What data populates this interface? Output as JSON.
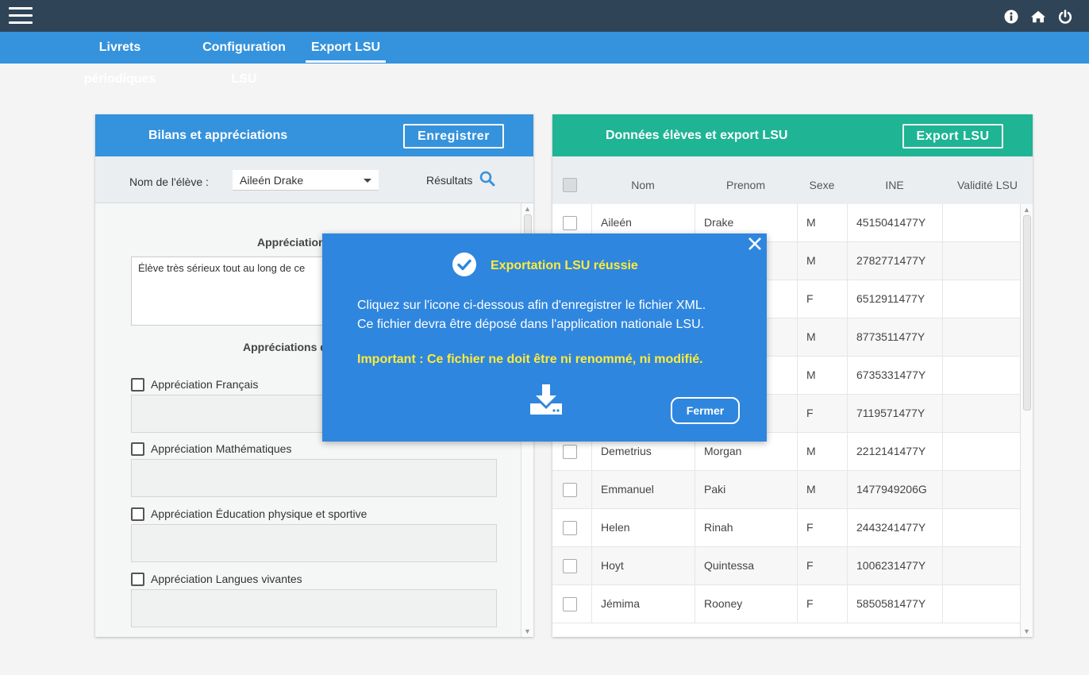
{
  "nav": {
    "tabs": [
      {
        "label": "Livrets périodiques",
        "active": false
      },
      {
        "label": "Configuration LSU",
        "active": false
      },
      {
        "label": "Export LSU",
        "active": true
      }
    ]
  },
  "left_panel": {
    "title": "Bilans et appréciations",
    "save_label": "Enregistrer",
    "student_label": "Nom de l'élève :",
    "student_selected": "Aileén Drake",
    "results_label": "Résultats",
    "general_title": "Appréciation",
    "general_text": "Élève très sérieux tout au long de ce",
    "subjects_title": "Appréciations d",
    "subjects": [
      {
        "label": "Appréciation Français"
      },
      {
        "label": "Appréciation Mathématiques"
      },
      {
        "label": "Appréciation Éducation physique et sportive"
      },
      {
        "label": "Appréciation Langues vivantes"
      }
    ]
  },
  "right_panel": {
    "title": "Données élèves et export LSU",
    "export_label": "Export LSU",
    "columns": [
      "Nom",
      "Prenom",
      "Sexe",
      "INE",
      "Validité LSU"
    ],
    "rows": [
      {
        "nom": "Aileén",
        "prenom": "Drake",
        "sexe": "M",
        "ine": "4515041477Y",
        "validite": ""
      },
      {
        "nom": "",
        "prenom": "",
        "sexe": "M",
        "ine": "2782771477Y",
        "validite": ""
      },
      {
        "nom": "",
        "prenom": "",
        "sexe": "F",
        "ine": "6512911477Y",
        "validite": ""
      },
      {
        "nom": "",
        "prenom": "",
        "sexe": "M",
        "ine": "8773511477Y",
        "validite": ""
      },
      {
        "nom": "",
        "prenom": "",
        "sexe": "M",
        "ine": "6735331477Y",
        "validite": ""
      },
      {
        "nom": "",
        "prenom": "",
        "sexe": "F",
        "ine": "7119571477Y",
        "validite": ""
      },
      {
        "nom": "Demetrius",
        "prenom": "Morgan",
        "sexe": "M",
        "ine": "2212141477Y",
        "validite": ""
      },
      {
        "nom": "Emmanuel",
        "prenom": "Paki",
        "sexe": "M",
        "ine": "1477949206G",
        "validite": ""
      },
      {
        "nom": "Helen",
        "prenom": "Rinah",
        "sexe": "F",
        "ine": "2443241477Y",
        "validite": ""
      },
      {
        "nom": "Hoyt",
        "prenom": "Quintessa",
        "sexe": "F",
        "ine": "1006231477Y",
        "validite": ""
      },
      {
        "nom": "Jémima",
        "prenom": "Rooney",
        "sexe": "F",
        "ine": "5850581477Y",
        "validite": ""
      }
    ]
  },
  "modal": {
    "title": "Exportation LSU réussie",
    "line1": "Cliquez sur l'icone ci-dessous afin d'enregistrer le fichier XML.",
    "line2": "Ce fichier devra être déposé dans l'application nationale LSU.",
    "important": "Important : Ce fichier ne doit être ni renommé, ni modifié.",
    "close_label": "Fermer"
  },
  "colors": {
    "topbar": "#2f4457",
    "nav": "#3592dc",
    "left_header": "#3592dc",
    "right_header": "#1eb494",
    "modal_bg": "#2f86de",
    "highlight_text": "#ffeb3b"
  },
  "icons": [
    "menu-icon",
    "info-icon",
    "home-icon",
    "power-icon",
    "search-icon",
    "check-circle-icon",
    "close-icon",
    "download-icon"
  ]
}
